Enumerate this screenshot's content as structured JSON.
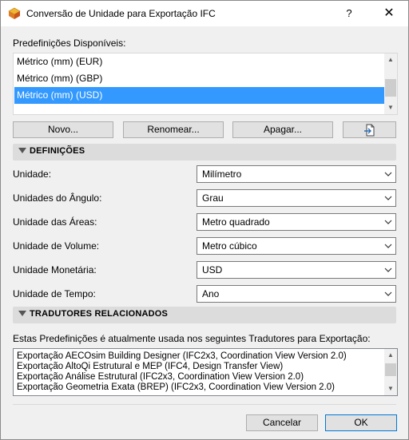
{
  "window": {
    "title": "Conversão de Unidade para Exportação IFC",
    "help_glyph": "?",
    "close_glyph": "✕"
  },
  "presets": {
    "label": "Predefinições Disponíveis:",
    "items": [
      {
        "label": "Métrico (mm) (EUR)"
      },
      {
        "label": "Métrico (mm) (GBP)"
      },
      {
        "label": "Métrico (mm) (USD)",
        "selected": true
      }
    ],
    "buttons": {
      "new": "Novo...",
      "rename": "Renomear...",
      "delete": "Apagar..."
    }
  },
  "definitions": {
    "title": "DEFINIÇÕES",
    "rows": [
      {
        "label": "Unidade:",
        "value": "Milímetro"
      },
      {
        "label": "Unidades do Ângulo:",
        "value": "Grau"
      },
      {
        "label": "Unidade das Áreas:",
        "value": "Metro quadrado"
      },
      {
        "label": "Unidade de Volume:",
        "value": "Metro cúbico"
      },
      {
        "label": "Unidade Monetária:",
        "value": "USD"
      },
      {
        "label": "Unidade de Tempo:",
        "value": "Ano"
      }
    ]
  },
  "translators": {
    "title": "TRADUTORES RELACIONADOS",
    "description": "Estas Predefinições é atualmente usada nos seguintes Tradutores para Exportação:",
    "items": [
      "Exportação AECOsim Building Designer (IFC2x3, Coordination View Version 2.0)",
      "Exportação AltoQi Estrutural e MEP (IFC4, Design Transfer View)",
      "Exportação Análise Estrutural (IFC2x3, Coordination View Version 2.0)",
      "Exportação Geometria Exata (BREP) (IFC2x3, Coordination View Version 2.0)"
    ]
  },
  "footer": {
    "cancel": "Cancelar",
    "ok": "OK"
  },
  "colors": {
    "selection": "#3399ff",
    "primary_border": "#0078d7"
  }
}
